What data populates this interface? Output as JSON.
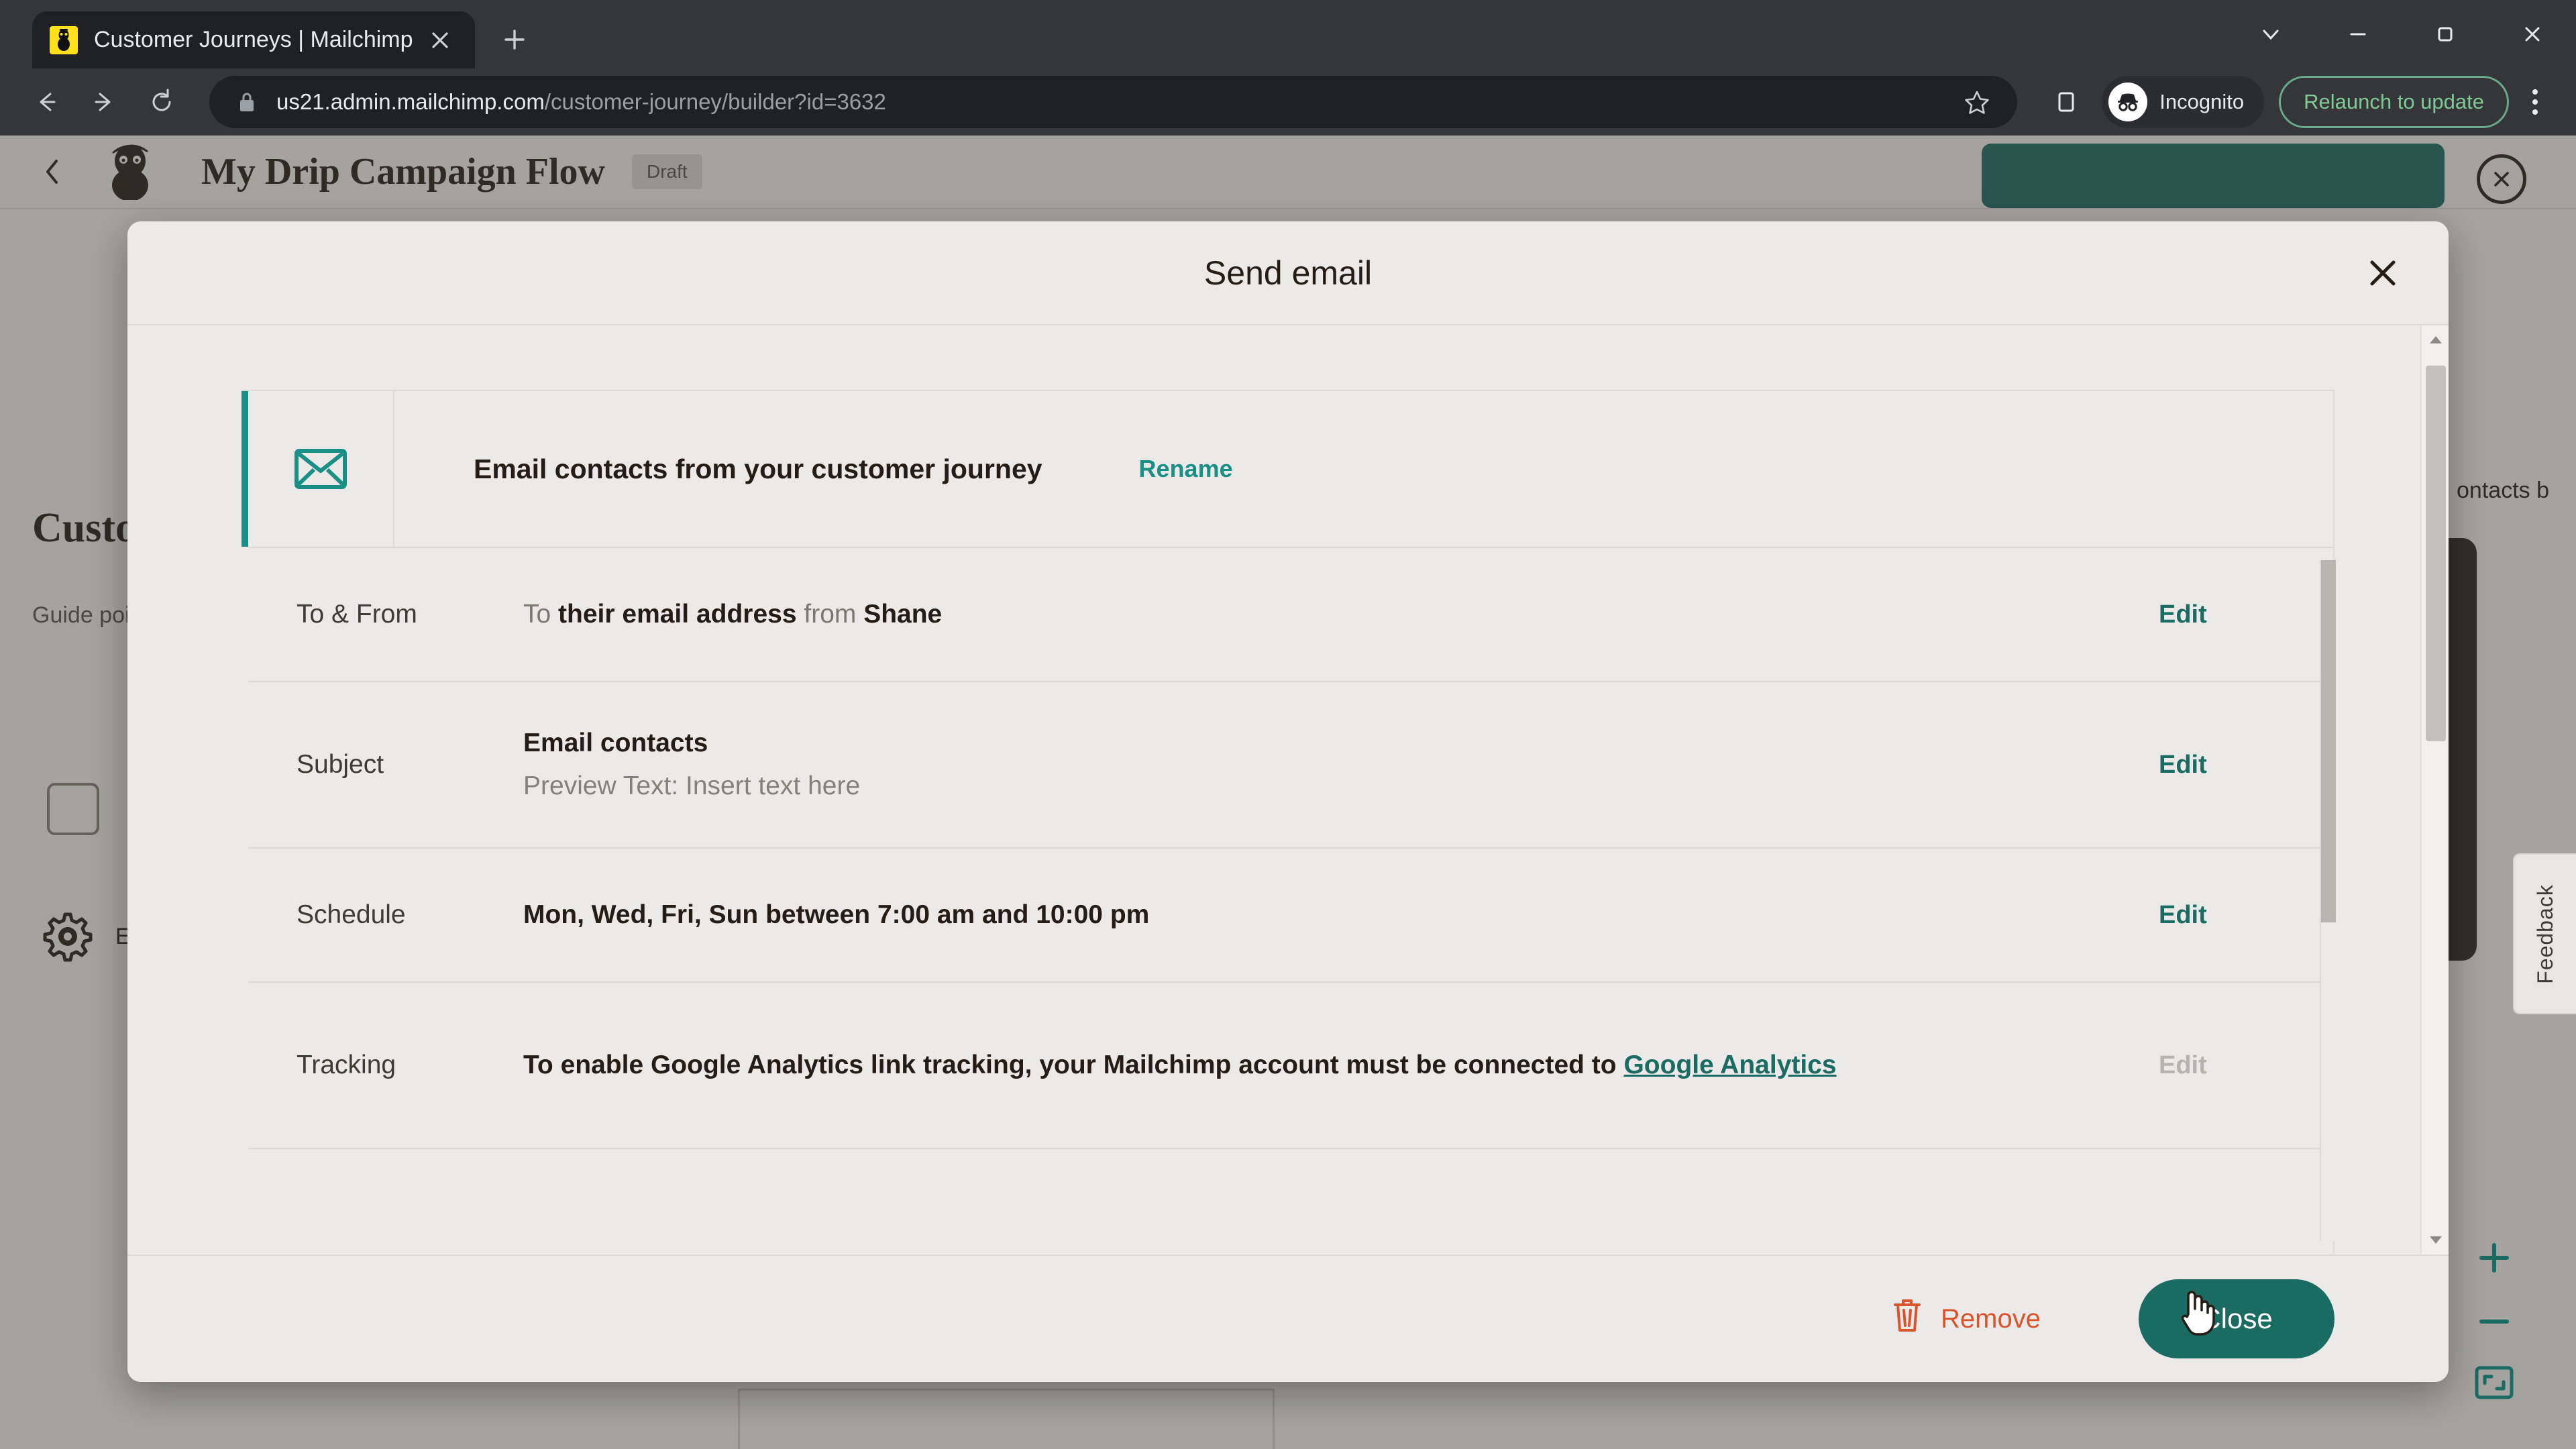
{
  "browser": {
    "tab": {
      "title": "Customer Journeys | Mailchimp",
      "favicon": "mailchimp-favicon",
      "close_icon": "close-icon"
    },
    "new_tab_icon": "plus-icon",
    "window_controls": [
      "chevron-down-icon",
      "minimize-icon",
      "maximize-icon",
      "close-icon"
    ],
    "nav": {
      "back_icon": "back-arrow-icon",
      "forward_icon": "forward-arrow-icon",
      "reload_icon": "reload-icon"
    },
    "omnibox": {
      "lock_icon": "lock-icon",
      "url_host": "us21.admin.mailchimp.com",
      "url_path": "/customer-journey/builder?id=3632",
      "star_icon": "bookmark-star-icon"
    },
    "side_panel_icon": "side-panel-icon",
    "profile": {
      "label": "Incognito",
      "icon": "incognito-icon"
    },
    "update_button": "Relaunch to update",
    "menu_icon": "kebab-menu-icon"
  },
  "app": {
    "back_icon": "back-chevron-icon",
    "logo_icon": "mailchimp-freddie-logo",
    "flow_title": "My Drip Campaign Flow",
    "status_badge": "Draft",
    "cta_button": "",
    "close_circle_icon": "close-circle-icon",
    "heading": "Custom",
    "subtext": "Guide\npoints",
    "checkbox_icon": "checkbox",
    "gear_icon": "gear-icon",
    "gear_label": "E",
    "right_text": "ontacts b",
    "feedback_tab": "Feedback",
    "zoom_in_icon": "plus-icon",
    "zoom_out_icon": "minus-icon",
    "fit_screen_icon": "fit-to-screen-icon"
  },
  "modal": {
    "title": "Send email",
    "close_icon": "close-icon",
    "card": {
      "icon": "envelope-icon",
      "title": "Email contacts from your customer journey",
      "rename_label": "Rename"
    },
    "rows": [
      {
        "label": "To & From",
        "value_prefix": "To ",
        "value_bold1": "their email address",
        "value_mid": " from ",
        "value_bold2": "Shane",
        "edit_label": "Edit",
        "edit_disabled": false
      },
      {
        "label": "Subject",
        "value_bold1": "Email contacts",
        "value_sub": "Preview Text: Insert text here",
        "edit_label": "Edit",
        "edit_disabled": false
      },
      {
        "label": "Schedule",
        "value_bold1": "Mon, Wed, Fri, Sun between 7:00 am and 10:00 pm",
        "edit_label": "Edit",
        "edit_disabled": false
      },
      {
        "label": "Tracking",
        "value_bold1": "To enable Google Analytics link tracking, your Mailchimp account must be connected to ",
        "value_link": "Google Analytics",
        "edit_label": "Edit",
        "edit_disabled": true
      }
    ],
    "footer": {
      "remove_label": "Remove",
      "remove_icon": "trash-icon",
      "close_label": "Close",
      "cursor_icon": "pointer-hand-cursor"
    },
    "scrollbar": {
      "up_arrow_icon": "caret-up-icon",
      "down_arrow_icon": "caret-down-icon"
    }
  },
  "colors": {
    "teal_accent": "#1a8f86",
    "teal_button": "#1a6b62",
    "orange_remove": "#d9552e",
    "mailchimp_yellow": "#ffe01b",
    "chrome_dark": "#202124",
    "chrome_toolbar": "#35363a",
    "modal_bg": "#ebeae8"
  }
}
